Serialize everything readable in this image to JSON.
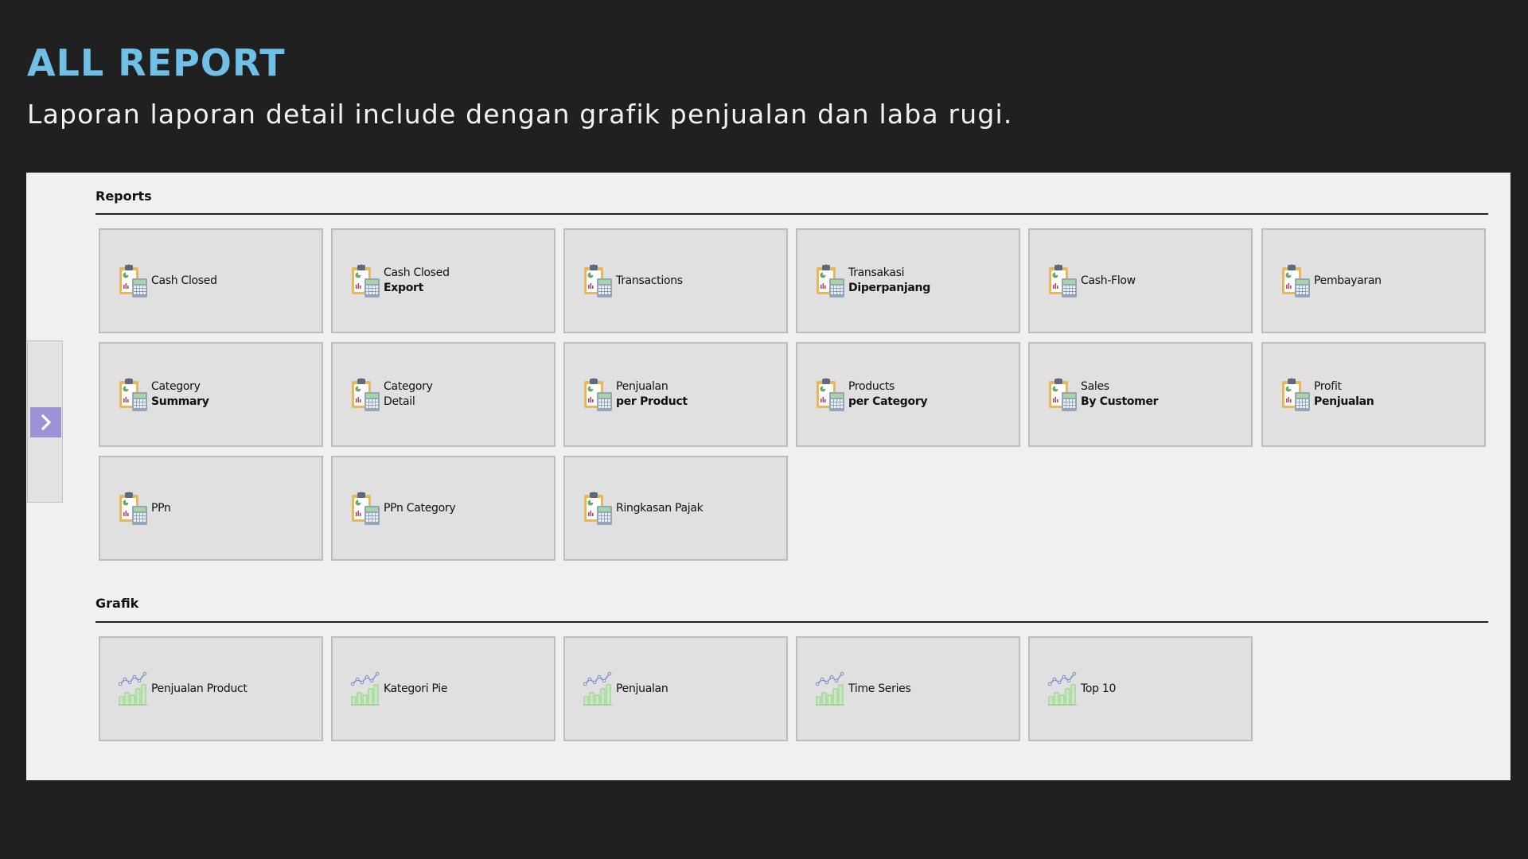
{
  "hero": {
    "title": "ALL REPORT",
    "subtitle": "Laporan laporan detail include dengan grafik penjualan dan laba rugi."
  },
  "colors": {
    "title": "#6fbfe6",
    "side_button": "#9b93d6",
    "tile_bg": "#e0e0e0",
    "panel_bg": "#f0f0f0",
    "page_bg": "#202020"
  },
  "side_panel": {
    "expand_icon": "chevron-right-icon"
  },
  "reports": {
    "heading": "Reports",
    "tiles": [
      {
        "line1": "Cash Closed",
        "line2": "",
        "icon": "report-clipboard-calculator-icon"
      },
      {
        "line1": "Cash Closed",
        "line2": "Export",
        "icon": "report-clipboard-calculator-icon"
      },
      {
        "line1": "Transactions",
        "line2": "",
        "icon": "report-clipboard-calculator-icon"
      },
      {
        "line1": "Transakasi",
        "line2": "Diperpanjang",
        "icon": "report-clipboard-calculator-icon"
      },
      {
        "line1": "Cash-Flow",
        "line2": "",
        "icon": "report-clipboard-calculator-icon"
      },
      {
        "line1": "Pembayaran",
        "line2": "",
        "icon": "report-clipboard-calculator-icon"
      },
      {
        "line1": "Category",
        "line2": "Summary",
        "icon": "report-clipboard-calculator-icon"
      },
      {
        "line1": "Category",
        "line2": "",
        "line1b": "Detail",
        "icon": "report-clipboard-calculator-icon"
      },
      {
        "line1": "Penjualan",
        "line2": "per Product",
        "icon": "report-clipboard-calculator-icon"
      },
      {
        "line1": "Products",
        "line2": "per Category",
        "icon": "report-clipboard-calculator-icon"
      },
      {
        "line1": "Sales",
        "line2": "By Customer",
        "icon": "report-clipboard-calculator-icon"
      },
      {
        "line1": "Profit",
        "line2": "Penjualan",
        "icon": "report-clipboard-calculator-icon"
      },
      {
        "line1": "PPn",
        "line2": "",
        "icon": "report-clipboard-calculator-icon"
      },
      {
        "line1": "PPn Category",
        "line2": "",
        "icon": "report-clipboard-calculator-icon"
      },
      {
        "line1": "Ringkasan Pajak",
        "line2": "",
        "icon": "report-clipboard-calculator-icon"
      }
    ]
  },
  "grafik": {
    "heading": "Grafik",
    "tiles": [
      {
        "line1": "Penjualan Product",
        "icon": "chart-bar-line-icon"
      },
      {
        "line1": "Kategori Pie",
        "icon": "chart-bar-line-icon"
      },
      {
        "line1": "Penjualan",
        "icon": "chart-bar-line-icon"
      },
      {
        "line1": "Time Series",
        "icon": "chart-bar-line-icon"
      },
      {
        "line1": "Top 10",
        "icon": "chart-bar-line-icon"
      }
    ]
  }
}
